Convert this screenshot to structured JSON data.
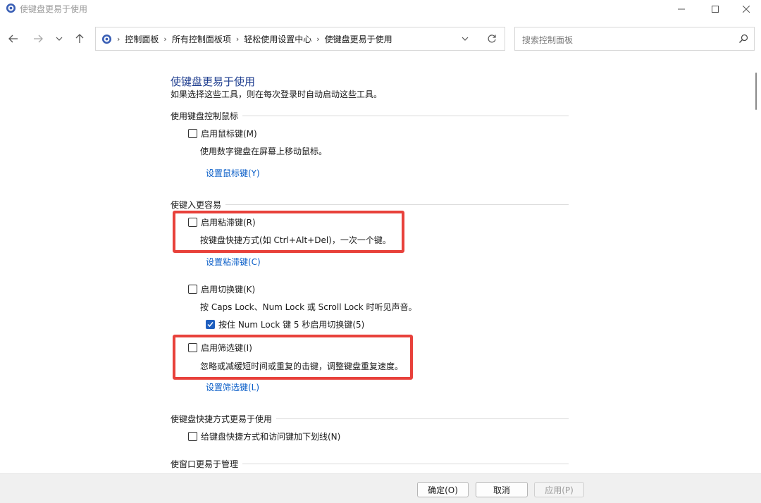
{
  "window": {
    "title": "使键盘更易于使用"
  },
  "breadcrumbs": [
    "控制面板",
    "所有控制面板项",
    "轻松使用设置中心",
    "使键盘更易于使用"
  ],
  "search": {
    "placeholder": "搜索控制面板"
  },
  "page": {
    "title": "使键盘更易于使用",
    "description": "如果选择这些工具，则在每次登录时自动启动这些工具。"
  },
  "groups": {
    "mouse": {
      "header": "使用键盘控制鼠标",
      "checkbox": "启用鼠标键(M)",
      "description": "使用数字键盘在屏幕上移动鼠标。",
      "link": "设置鼠标键(Y)"
    },
    "typing": {
      "header": "使键入更容易",
      "sticky": {
        "checkbox": "启用粘滞键(R)",
        "description": "按键盘快捷方式(如 Ctrl+Alt+Del)，一次一个键。",
        "link": "设置粘滞键(C)"
      },
      "toggle": {
        "checkbox": "启用切换键(K)",
        "description": "按 Caps Lock、Num Lock 或 Scroll Lock 时听见声音。",
        "sub_checkbox": "按住 Num Lock 键 5 秒启用切换键(5)"
      },
      "filter": {
        "checkbox": "启用筛选键(I)",
        "description": "忽略或减缓短时间或重复的击键，调整键盘重复速度。",
        "link": "设置筛选键(L)"
      }
    },
    "shortcuts": {
      "header": "使键盘快捷方式更易于使用",
      "checkbox": "给键盘快捷方式和访问键加下划线(N)"
    },
    "windows": {
      "header": "使窗口更易于管理"
    }
  },
  "checkbox_states": {
    "mouse_keys": false,
    "sticky_keys": false,
    "toggle_keys": false,
    "toggle_num_lock_hold": true,
    "filter_keys": false,
    "underline_shortcuts": false
  },
  "buttons": {
    "ok": "确定(O)",
    "cancel": "取消",
    "apply": "应用(P)"
  },
  "colors": {
    "title_blue": "#1e3d8f",
    "link_blue": "#0a5ec8",
    "highlight_red": "#e8413b",
    "checkbox_checked": "#1f5fbf"
  },
  "icons": [
    "control-panel-icon",
    "back-arrow-icon",
    "forward-arrow-icon",
    "chevron-down-icon",
    "up-arrow-icon",
    "refresh-icon",
    "search-icon",
    "minimize-icon",
    "maximize-icon",
    "close-icon"
  ]
}
